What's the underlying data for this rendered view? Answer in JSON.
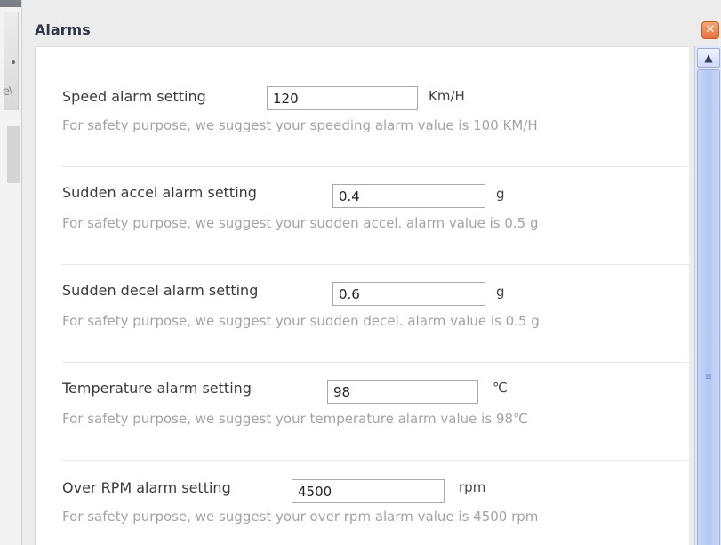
{
  "dialog": {
    "title": "Alarms",
    "close_label": "✕"
  },
  "background": {
    "fragment_text": "e\\"
  },
  "alarms": [
    {
      "label": "Speed alarm setting",
      "value": "120",
      "unit": "Km/H",
      "hint": "For safety purpose, we suggest your speeding alarm value is 100 KM/H"
    },
    {
      "label": "Sudden accel alarm setting",
      "value": "0.4",
      "unit": "g",
      "hint": "For safety purpose, we suggest your sudden accel. alarm value is 0.5 g"
    },
    {
      "label": "Sudden decel alarm setting",
      "value": "0.6",
      "unit": "g",
      "hint": "For safety purpose, we suggest your sudden decel. alarm value is 0.5 g"
    },
    {
      "label": "Temperature alarm setting",
      "value": "98",
      "unit": "℃",
      "hint": "For safety purpose, we suggest your temperature alarm value is 98℃"
    },
    {
      "label": "Over RPM alarm setting",
      "value": "4500",
      "unit": "rpm",
      "hint": "For safety purpose, we suggest your over rpm alarm value is 4500 rpm"
    }
  ],
  "scrollbar": {
    "up_arrow": "▲",
    "grip": "≡"
  }
}
